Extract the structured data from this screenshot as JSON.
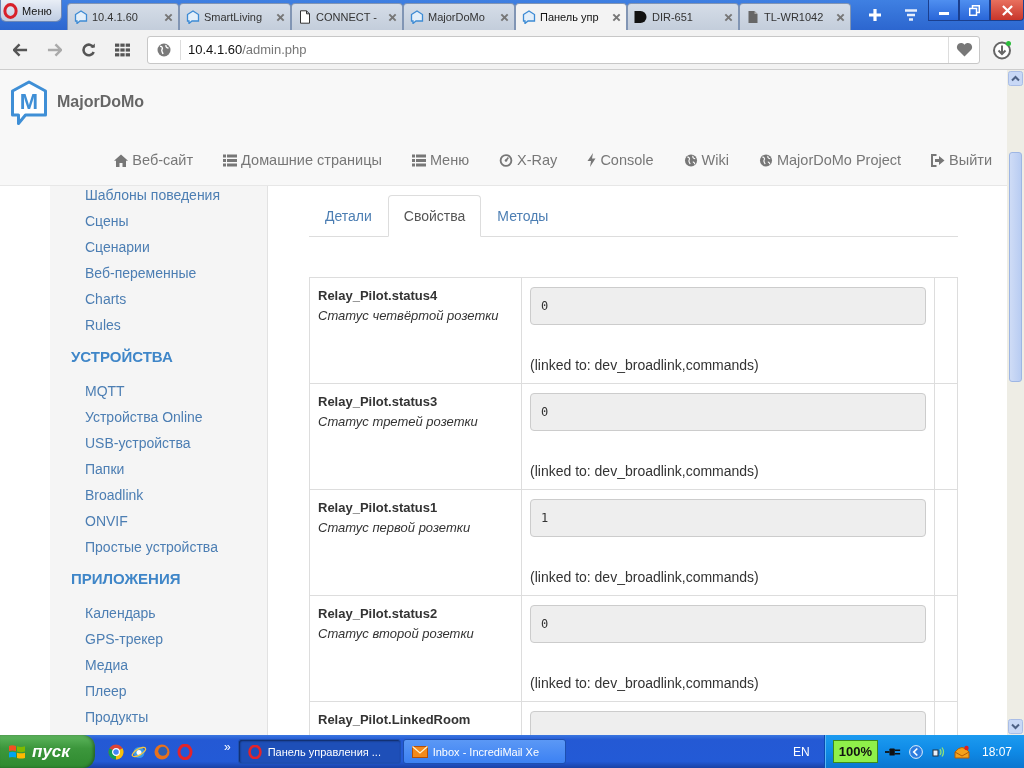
{
  "browser": {
    "menu_button": "Меню",
    "tabs": [
      {
        "title": "10.4.1.60",
        "kind": "majordomo",
        "selected": false
      },
      {
        "title": "SmartLiving",
        "kind": "majordomo",
        "selected": false
      },
      {
        "title": "CONNECT -",
        "kind": "page",
        "selected": false
      },
      {
        "title": "MajorDoMo",
        "kind": "majordomo",
        "selected": false
      },
      {
        "title": "Панель упр",
        "kind": "majordomo",
        "selected": true
      },
      {
        "title": "DIR-651",
        "kind": "dlink",
        "selected": false
      },
      {
        "title": "TL-WR1042",
        "kind": "file",
        "selected": false
      }
    ],
    "address": {
      "host": "10.4.1.60",
      "path": "/admin.php"
    }
  },
  "navbar": {
    "logo_letter": "M",
    "brand": "MajorDoMo",
    "links": [
      {
        "label": "Веб-сайт",
        "kind": "home"
      },
      {
        "label": "Домашние страницы",
        "kind": "list"
      },
      {
        "label": "Меню",
        "kind": "list"
      },
      {
        "label": "X-Ray",
        "kind": "gauge"
      },
      {
        "label": "Console",
        "kind": "bolt"
      },
      {
        "label": "Wiki",
        "kind": "globe"
      },
      {
        "label": "MajorDoMo Project",
        "kind": "globe"
      },
      {
        "label": "Выйти",
        "kind": "logout"
      }
    ]
  },
  "sidebar": {
    "groups": [
      {
        "items": [
          "Шаблоны поведения",
          "Сцены",
          "Сценарии",
          "Веб-переменные",
          "Charts",
          "Rules"
        ]
      },
      {
        "heading": "УСТРОЙСТВА",
        "items": [
          "MQTT",
          "Устройства Online",
          "USB-устройства",
          "Папки",
          "Broadlink",
          "ONVIF",
          "Простые устройства"
        ]
      },
      {
        "heading": "ПРИЛОЖЕНИЯ",
        "items": [
          "Календарь",
          "GPS-трекер",
          "Медиа",
          "Плеер",
          "Продукты"
        ]
      }
    ]
  },
  "content_tabs": [
    {
      "label": "Детали",
      "selected": false
    },
    {
      "label": "Свойства",
      "selected": true
    },
    {
      "label": "Методы",
      "selected": false
    }
  ],
  "properties": [
    {
      "name": "Relay_Pilot.status4",
      "description": "Статус четвёртой розетки",
      "value": "0",
      "linked": "(linked to: dev_broadlink,commands)"
    },
    {
      "name": "Relay_Pilot.status3",
      "description": "Статус третей розетки",
      "value": "0",
      "linked": "(linked to: dev_broadlink,commands)"
    },
    {
      "name": "Relay_Pilot.status1",
      "description": "Статус первой розетки",
      "value": "1",
      "linked": "(linked to: dev_broadlink,commands)"
    },
    {
      "name": "Relay_Pilot.status2",
      "description": "Статус второй розетки",
      "value": "0",
      "linked": "(linked to: dev_broadlink,commands)"
    },
    {
      "name": "Relay_Pilot.LinkedRoom"
    }
  ],
  "taskbar": {
    "start": "пуск",
    "more": "»",
    "tasks": [
      {
        "label": "Панель управления ...",
        "kind": "ring",
        "selected": true
      },
      {
        "label": "Inbox - IncrediMail Xe",
        "kind": "envelope",
        "selected": false
      }
    ],
    "language": "EN",
    "status_indicator": "100%",
    "clock": "18:07"
  }
}
